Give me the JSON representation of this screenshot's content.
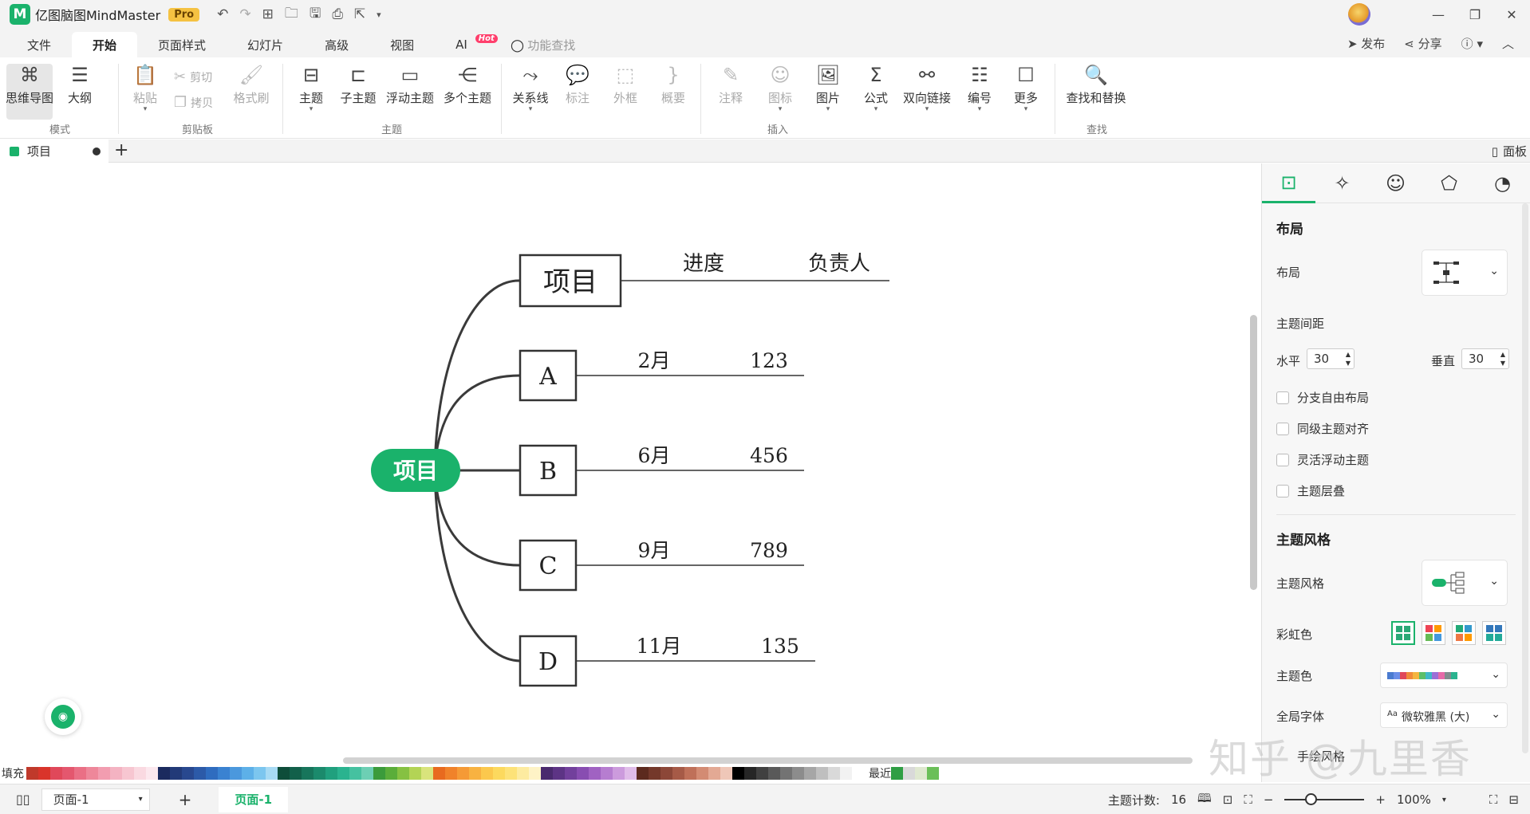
{
  "app": {
    "logo": "M",
    "title": "亿图脑图MindMaster",
    "pro_badge": "Pro"
  },
  "quick_access": [
    "undo-icon",
    "redo-icon",
    "new-icon",
    "open-icon",
    "save-icon",
    "print-icon",
    "export-icon",
    "customize-icon"
  ],
  "menu": {
    "tabs": [
      "文件",
      "开始",
      "页面样式",
      "幻灯片",
      "高级",
      "视图"
    ],
    "active": "开始",
    "ai_label": "AI",
    "hot_badge": "Hot",
    "search_placeholder": "功能查找",
    "publish": "发布",
    "share": "分享",
    "help": "?"
  },
  "ribbon": {
    "mode": {
      "group": "模式",
      "mindmap": "思维导图",
      "outline": "大纲"
    },
    "clipboard": {
      "group": "剪贴板",
      "paste": "粘贴",
      "cut": "剪切",
      "copy": "拷贝",
      "format_painter": "格式刷"
    },
    "topic": {
      "group": "主题",
      "topic": "主题",
      "subtopic": "子主题",
      "floating": "浮动主题",
      "multiple": "多个主题"
    },
    "insert": {
      "group": "插入",
      "relation": "关系线",
      "callout": "标注",
      "boundary": "外框",
      "summary": "概要",
      "note": "注释",
      "icon": "图标",
      "image": "图片",
      "formula": "公式",
      "link": "双向链接",
      "numbering": "编号",
      "more": "更多"
    },
    "find": {
      "group": "查找",
      "find_replace": "查找和替换"
    }
  },
  "doc_tab": {
    "name": "项目",
    "add": "+",
    "panel": "面板"
  },
  "mindmap": {
    "root": "项目",
    "header": {
      "label": "项目",
      "col1": "进度",
      "col2": "负责人"
    },
    "rows": [
      {
        "label": "A",
        "progress": "2月",
        "owner": "123"
      },
      {
        "label": "B",
        "progress": "6月",
        "owner": "456"
      },
      {
        "label": "C",
        "progress": "9月",
        "owner": "789"
      },
      {
        "label": "D",
        "progress": "11月",
        "owner": "135"
      }
    ],
    "root_color": "#1ab26b"
  },
  "palette": {
    "fill_label": "填充",
    "recent_label": "最近"
  },
  "status": {
    "page_select": "页面-1",
    "page_tab": "页面-1",
    "topic_count_label": "主题计数:",
    "topic_count": "16",
    "zoom": "100%"
  },
  "panel": {
    "tabs": [
      "layout-icon",
      "ai-sparkle-icon",
      "emoji-icon",
      "theme-icon",
      "clock-icon"
    ],
    "layout_section": "布局",
    "layout_label": "布局",
    "spacing_label": "主题间距",
    "horizontal_label": "水平",
    "horizontal_value": "30",
    "vertical_label": "垂直",
    "vertical_value": "30",
    "options": [
      "分支自由布局",
      "同级主题对齐",
      "灵活浮动主题",
      "主题层叠"
    ],
    "style_section": "主题风格",
    "style_label": "主题风格",
    "rainbow_label": "彩虹色",
    "theme_color_label": "主题色",
    "font_label": "全局字体",
    "font_value": "微软雅黑 (大)",
    "hand_label": "手绘风格"
  },
  "watermark": "知乎 @九里香",
  "colors": {
    "brand": "#1ab26b",
    "hot": "#ff3f6c",
    "pro": "#f5c242"
  }
}
